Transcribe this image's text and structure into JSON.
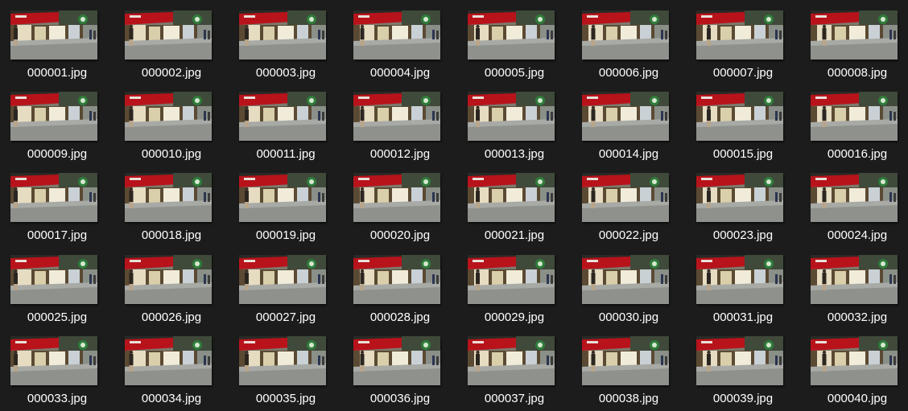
{
  "files": [
    {
      "name": "000001.jpg"
    },
    {
      "name": "000002.jpg"
    },
    {
      "name": "000003.jpg"
    },
    {
      "name": "000004.jpg"
    },
    {
      "name": "000005.jpg"
    },
    {
      "name": "000006.jpg"
    },
    {
      "name": "000007.jpg"
    },
    {
      "name": "000008.jpg"
    },
    {
      "name": "000009.jpg"
    },
    {
      "name": "000010.jpg"
    },
    {
      "name": "000011.jpg"
    },
    {
      "name": "000012.jpg"
    },
    {
      "name": "000013.jpg"
    },
    {
      "name": "000014.jpg"
    },
    {
      "name": "000015.jpg"
    },
    {
      "name": "000016.jpg"
    },
    {
      "name": "000017.jpg"
    },
    {
      "name": "000018.jpg"
    },
    {
      "name": "000019.jpg"
    },
    {
      "name": "000020.jpg"
    },
    {
      "name": "000021.jpg"
    },
    {
      "name": "000022.jpg"
    },
    {
      "name": "000023.jpg"
    },
    {
      "name": "000024.jpg"
    },
    {
      "name": "000025.jpg"
    },
    {
      "name": "000026.jpg"
    },
    {
      "name": "000027.jpg"
    },
    {
      "name": "000028.jpg"
    },
    {
      "name": "000029.jpg"
    },
    {
      "name": "000030.jpg"
    },
    {
      "name": "000031.jpg"
    },
    {
      "name": "000032.jpg"
    },
    {
      "name": "000033.jpg"
    },
    {
      "name": "000034.jpg"
    },
    {
      "name": "000035.jpg"
    },
    {
      "name": "000036.jpg"
    },
    {
      "name": "000037.jpg"
    },
    {
      "name": "000038.jpg"
    },
    {
      "name": "000039.jpg"
    },
    {
      "name": "000040.jpg"
    }
  ],
  "thumbnail_icon": "image-thumbnail",
  "colors": {
    "background": "#1c1c1c",
    "text": "#ffffff"
  }
}
